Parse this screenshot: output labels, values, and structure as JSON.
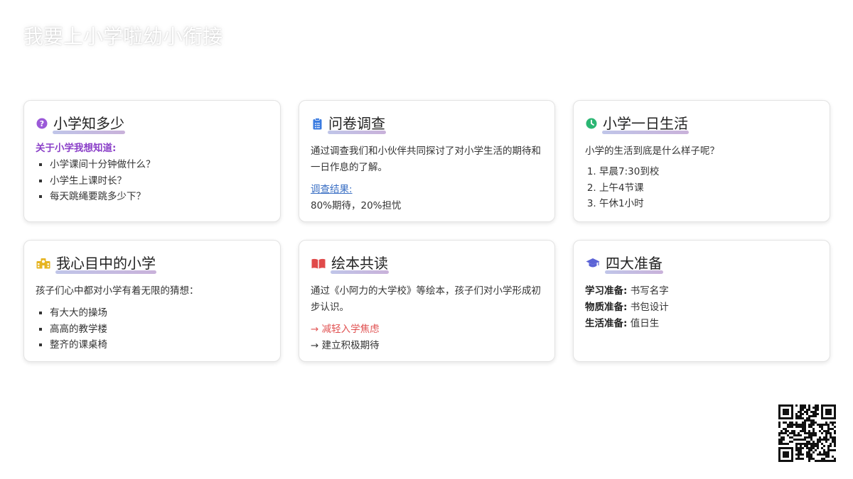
{
  "page": {
    "title": "我要上小学啦幼小衔接"
  },
  "colors": {
    "accent_purple": "#8a3fc8",
    "icon_blue": "#3a7be0",
    "icon_green": "#2bb673",
    "icon_yellow": "#e6b422",
    "icon_red": "#e04a4a",
    "icon_indigo": "#5b63d6",
    "link_blue": "#3a6fc4",
    "warn_red": "#e05050"
  },
  "cards": {
    "c1": {
      "icon": "question-circle-icon",
      "title": "小学知多少",
      "label": "关于小学我想知道:",
      "items": [
        "小学课间十分钟做什么？",
        "小学生上课时长？",
        "每天跳绳要跳多少下？"
      ]
    },
    "c2": {
      "icon": "clipboard-list-icon",
      "title": "问卷调查",
      "text": "通过调查我们和小伙伴共同探讨了对小学生活的期待和一日作息的了解。",
      "link": "调查结果:",
      "result": "80%期待，20%担忧"
    },
    "c3": {
      "icon": "clock-icon",
      "title": "小学一日生活",
      "text": "小学的生活到底是什么样子呢？",
      "items": [
        "早晨7:30到校",
        "上午4节课",
        "午休1小时"
      ]
    },
    "c4": {
      "icon": "school-icon",
      "title": "我心目中的小学",
      "text": "孩子们心中都对小学有着无限的猜想：",
      "items": [
        "有大大的操场",
        "高高的教学楼",
        "整齐的课桌椅"
      ]
    },
    "c5": {
      "icon": "open-book-icon",
      "title": "绘本共读",
      "text": "通过《小阿力的大学校》等绘本，孩子们对小学形成初步认识。",
      "line1": "→ 减轻入学焦虑",
      "line2": "→ 建立积极期待"
    },
    "c6": {
      "icon": "graduation-cap-icon",
      "title": "四大准备",
      "rows": [
        {
          "label": "学习准备:",
          "value": "书写名字"
        },
        {
          "label": "物质准备:",
          "value": "书包设计"
        },
        {
          "label": "生活准备:",
          "value": "值日生"
        }
      ]
    }
  }
}
